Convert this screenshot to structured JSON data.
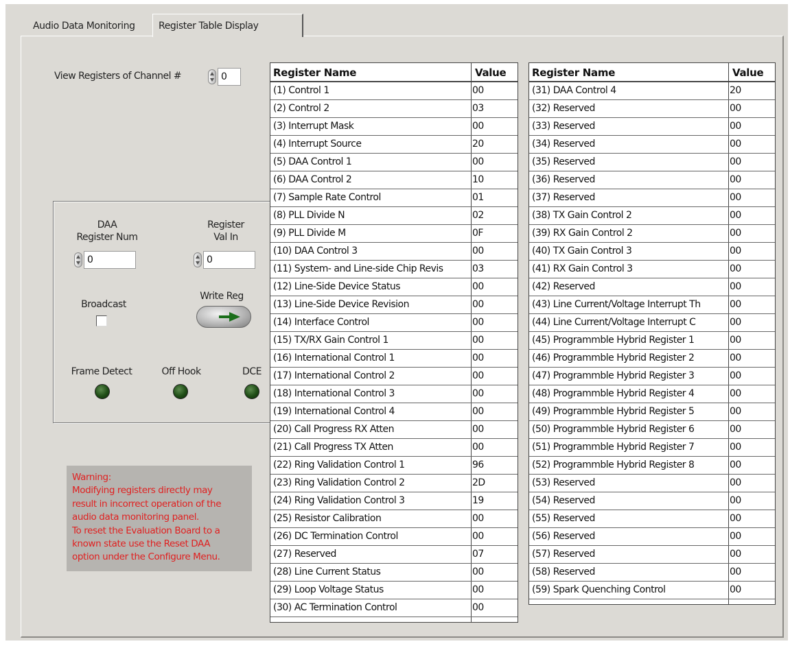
{
  "tabs": [
    {
      "label": "Audio Data Monitoring",
      "active": false
    },
    {
      "label": "Register Table Display",
      "active": true
    }
  ],
  "channel": {
    "label": "View Registers of Channel #",
    "value": "0"
  },
  "daa_register_num": {
    "label_line1": "DAA",
    "label_line2": "Register Num",
    "value": "0"
  },
  "register_val_in": {
    "label_line1": "Register",
    "label_line2": "Val In",
    "value": "0"
  },
  "broadcast": {
    "label": "Broadcast",
    "checked": false
  },
  "write_reg": {
    "label": "Write Reg"
  },
  "indicators": [
    {
      "label": "Frame Detect",
      "on": false
    },
    {
      "label": "Off Hook",
      "on": false
    },
    {
      "label": "DCE",
      "on": false
    }
  ],
  "warning": {
    "color": "#e02020",
    "lines": [
      "Warning:",
      "Modifying registers directly may",
      "result in incorrect operation of the",
      "audio data monitoring panel.",
      "To reset the Evaluation Board to a",
      "known state use the Reset DAA",
      "option under the Configure Menu."
    ]
  },
  "tables": [
    {
      "header_name": "Register Name",
      "header_value": "Value",
      "rows": [
        {
          "name": "(1)   Control 1",
          "value": "00"
        },
        {
          "name": "(2)   Control 2",
          "value": "03"
        },
        {
          "name": "(3)   Interrupt Mask",
          "value": "00"
        },
        {
          "name": "(4)   Interrupt Source",
          "value": "20"
        },
        {
          "name": "(5)   DAA Control 1",
          "value": "00"
        },
        {
          "name": "(6)   DAA Control 2",
          "value": "10"
        },
        {
          "name": "(7)   Sample Rate Control",
          "value": "01"
        },
        {
          "name": "(8)   PLL Divide N",
          "value": "02"
        },
        {
          "name": "(9)   PLL Divide M",
          "value": "0F"
        },
        {
          "name": "(10)  DAA Control 3",
          "value": "00"
        },
        {
          "name": "(11)  System- and Line-side Chip Revis",
          "value": "03"
        },
        {
          "name": "(12)  Line-Side Device Status",
          "value": "00"
        },
        {
          "name": "(13)  Line-Side Device Revision",
          "value": "00"
        },
        {
          "name": "(14)  Interface Control",
          "value": "00"
        },
        {
          "name": "(15)  TX/RX Gain Control 1",
          "value": "00"
        },
        {
          "name": "(16)  International Control 1",
          "value": "00"
        },
        {
          "name": "(17)  International Control 2",
          "value": "00"
        },
        {
          "name": "(18)  International Control 3",
          "value": "00"
        },
        {
          "name": "(19)  International Control 4",
          "value": "00"
        },
        {
          "name": "(20)  Call Progress RX Atten",
          "value": "00"
        },
        {
          "name": "(21)  Call Progress TX Atten",
          "value": "00"
        },
        {
          "name": "(22)  Ring Validation Control 1",
          "value": "96"
        },
        {
          "name": "(23)  Ring Validation Control 2",
          "value": "2D"
        },
        {
          "name": "(24)  Ring Validation Control 3",
          "value": "19"
        },
        {
          "name": "(25)  Resistor Calibration",
          "value": "00"
        },
        {
          "name": "(26)  DC Termination Control",
          "value": "00"
        },
        {
          "name": "(27)  Reserved",
          "value": "07"
        },
        {
          "name": "(28)  Line Current Status",
          "value": "00"
        },
        {
          "name": "(29)  Loop Voltage Status",
          "value": "00"
        },
        {
          "name": "(30)  AC Termination Control",
          "value": "00"
        }
      ]
    },
    {
      "header_name": "Register Name",
      "header_value": "Value",
      "rows": [
        {
          "name": "(31)  DAA Control 4",
          "value": "20"
        },
        {
          "name": "(32)  Reserved",
          "value": "00"
        },
        {
          "name": "(33)  Reserved",
          "value": "00"
        },
        {
          "name": "(34)  Reserved",
          "value": "00"
        },
        {
          "name": "(35)  Reserved",
          "value": "00"
        },
        {
          "name": "(36)  Reserved",
          "value": "00"
        },
        {
          "name": "(37)  Reserved",
          "value": "00"
        },
        {
          "name": "(38)  TX Gain Control 2",
          "value": "00"
        },
        {
          "name": "(39)  RX Gain Control 2",
          "value": "00"
        },
        {
          "name": "(40)  TX Gain Control 3",
          "value": "00"
        },
        {
          "name": "(41)  RX Gain Control 3",
          "value": "00"
        },
        {
          "name": "(42)  Reserved",
          "value": "00"
        },
        {
          "name": "(43)  Line Current/Voltage Interrupt Th",
          "value": "00"
        },
        {
          "name": "(44)  Line Current/Voltage Interrupt C",
          "value": "00"
        },
        {
          "name": "(45)  Programmble Hybrid Register 1",
          "value": "00"
        },
        {
          "name": "(46)  Programmble Hybrid Register 2",
          "value": "00"
        },
        {
          "name": "(47)  Programmble Hybrid Register 3",
          "value": "00"
        },
        {
          "name": "(48)  Programmble Hybrid Register 4",
          "value": "00"
        },
        {
          "name": "(49)  Programmble Hybrid Register 5",
          "value": "00"
        },
        {
          "name": "(50)  Programmble Hybrid Register 6",
          "value": "00"
        },
        {
          "name": "(51)  Programmble Hybrid Register 7",
          "value": "00"
        },
        {
          "name": "(52)  Programmble Hybrid Register 8",
          "value": "00"
        },
        {
          "name": "(53)  Reserved",
          "value": "00"
        },
        {
          "name": "(54)  Reserved",
          "value": "00"
        },
        {
          "name": "(55)  Reserved",
          "value": "00"
        },
        {
          "name": "(56)  Reserved",
          "value": "00"
        },
        {
          "name": "(57)  Reserved",
          "value": "00"
        },
        {
          "name": "(58)  Reserved",
          "value": "00"
        },
        {
          "name": "(59)  Spark Quenching Control",
          "value": "00"
        }
      ]
    }
  ]
}
